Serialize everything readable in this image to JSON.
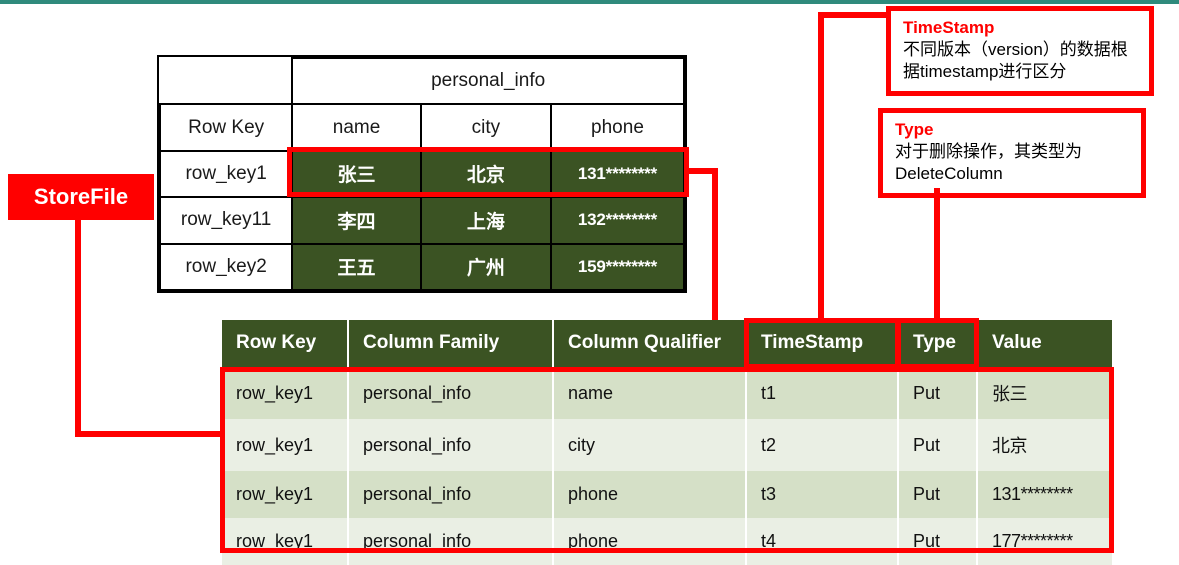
{
  "theme": {
    "accent_red": "#ff0000",
    "table_green": "#3b5323",
    "row_green_dark": "#d5e0c7",
    "row_green_light": "#eaefe4",
    "top_rule_teal": "#2f8a7c"
  },
  "storefile_label": "StoreFile",
  "logical_table": {
    "column_family": "personal_info",
    "row_key_header": "Row Key",
    "qualifiers": [
      "name",
      "city",
      "phone"
    ],
    "rows": [
      {
        "row_key": "row_key1",
        "name": "张三",
        "city": "北京",
        "phone": "131********"
      },
      {
        "row_key": "row_key11",
        "name": "李四",
        "city": "上海",
        "phone": "132********"
      },
      {
        "row_key": "row_key2",
        "name": "王五",
        "city": "广州",
        "phone": "159********"
      }
    ]
  },
  "storefile_table": {
    "headers": [
      "Row Key",
      "Column Family",
      "Column Qualifier",
      "TimeStamp",
      "Type",
      "Value"
    ],
    "rows": [
      {
        "row_key": "row_key1",
        "column_family": "personal_info",
        "column_qualifier": "name",
        "timestamp": "t1",
        "type": "Put",
        "value": "张三"
      },
      {
        "row_key": "row_key1",
        "column_family": "personal_info",
        "column_qualifier": "city",
        "timestamp": "t2",
        "type": "Put",
        "value": "北京"
      },
      {
        "row_key": "row_key1",
        "column_family": "personal_info",
        "column_qualifier": "phone",
        "timestamp": "t3",
        "type": "Put",
        "value": "131********"
      },
      {
        "row_key": "row_key1",
        "column_family": "personal_info",
        "column_qualifier": "phone",
        "timestamp": "t4",
        "type": "Put",
        "value": "177********"
      }
    ]
  },
  "callouts": [
    {
      "title": "TimeStamp",
      "body": "不同版本（version）的数据根据timestamp进行区分"
    },
    {
      "title": "Type",
      "body": "对于删除操作，其类型为 DeleteColumn"
    }
  ]
}
